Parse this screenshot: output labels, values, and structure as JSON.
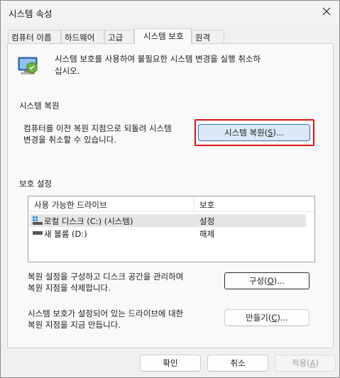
{
  "window": {
    "title": "시스템 속성"
  },
  "tabs": [
    {
      "label": "컴퓨터 이름"
    },
    {
      "label": "하드웨어"
    },
    {
      "label": "고급"
    },
    {
      "label": "시스템 보호"
    },
    {
      "label": "원격"
    }
  ],
  "active_tab": "시스템 보호",
  "intro": {
    "icon": "system-protection-icon",
    "text_line1": "시스템 보호를 사용하여 불필요한 시스템 변경을 실행 취소하",
    "text_line2": "십시오."
  },
  "restore": {
    "heading": "시스템 복원",
    "desc_line1": "컴퓨터를 이전 복원 지점으로 되돌려 시스템",
    "desc_line2": "변경을 취소할 수 있습니다.",
    "button_pre": "시스템 복원(",
    "button_key": "S",
    "button_post": ")..."
  },
  "protection": {
    "heading": "보호 설정",
    "columns": [
      "사용 가능한 드라이브",
      "보호"
    ],
    "drives": [
      {
        "name": "로컬 디스크 (C:) (시스템)",
        "status": "설정",
        "icon": "windows-drive-icon",
        "selected": true
      },
      {
        "name": "새 볼륨 (D:)",
        "status": "해제",
        "icon": "drive-icon",
        "selected": false
      }
    ]
  },
  "configure": {
    "desc_line1": "복원 설정을 구성하고 디스크 공간을 관리하며",
    "desc_line2": "복원 지점을 삭제합니다.",
    "button_pre": "구성(",
    "button_key": "O",
    "button_post": ")..."
  },
  "create": {
    "desc_line1": "시스템 보호가 설정되어 있는 드라이브에 대한",
    "desc_line2": "복원 지점을 지금 만듭니다.",
    "button_pre": "만들기(",
    "button_key": "C",
    "button_post": ")..."
  },
  "footer": {
    "ok": "확인",
    "cancel": "취소",
    "apply_pre": "적용(",
    "apply_key": "A",
    "apply_post": ")"
  },
  "colors": {
    "highlight_border": "#e01414",
    "primary_button": "#dbe9f7"
  }
}
